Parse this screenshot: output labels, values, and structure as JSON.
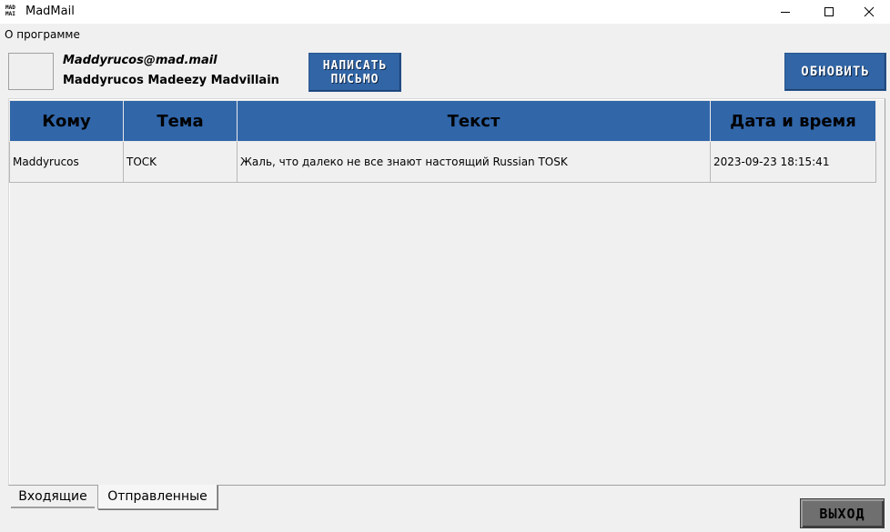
{
  "window": {
    "title": "MadMail",
    "icon_name": "madmail-logo-icon",
    "controls": [
      "minimize-icon",
      "maximize-icon",
      "close-icon"
    ]
  },
  "menu": {
    "about": "О программе"
  },
  "user": {
    "email": "Maddyrucos@mad.mail",
    "name": "Maddyrucos Madeezy Madvillain"
  },
  "buttons": {
    "compose_line1": "НАПИСАТЬ",
    "compose_line2": "ПИСЬМО",
    "refresh": "ОБНОВИТЬ",
    "exit": "ВЫХОД"
  },
  "table": {
    "columns": [
      "Кому",
      "Тема",
      "Текст",
      "Дата и время"
    ],
    "rows": [
      {
        "to": "Maddyrucos",
        "subject": "TOCK",
        "text": "Жаль, что далеко не все знают настоящий Russian TOSK",
        "datetime": "2023-09-23 18:15:41"
      }
    ]
  },
  "tabs": {
    "inbox": "Входящие",
    "sent": "Отправленные",
    "active": "Отправленные"
  },
  "colors": {
    "accent": "#3165a5",
    "exit_button": "#6f6f6f",
    "background": "#f0f0f0"
  }
}
